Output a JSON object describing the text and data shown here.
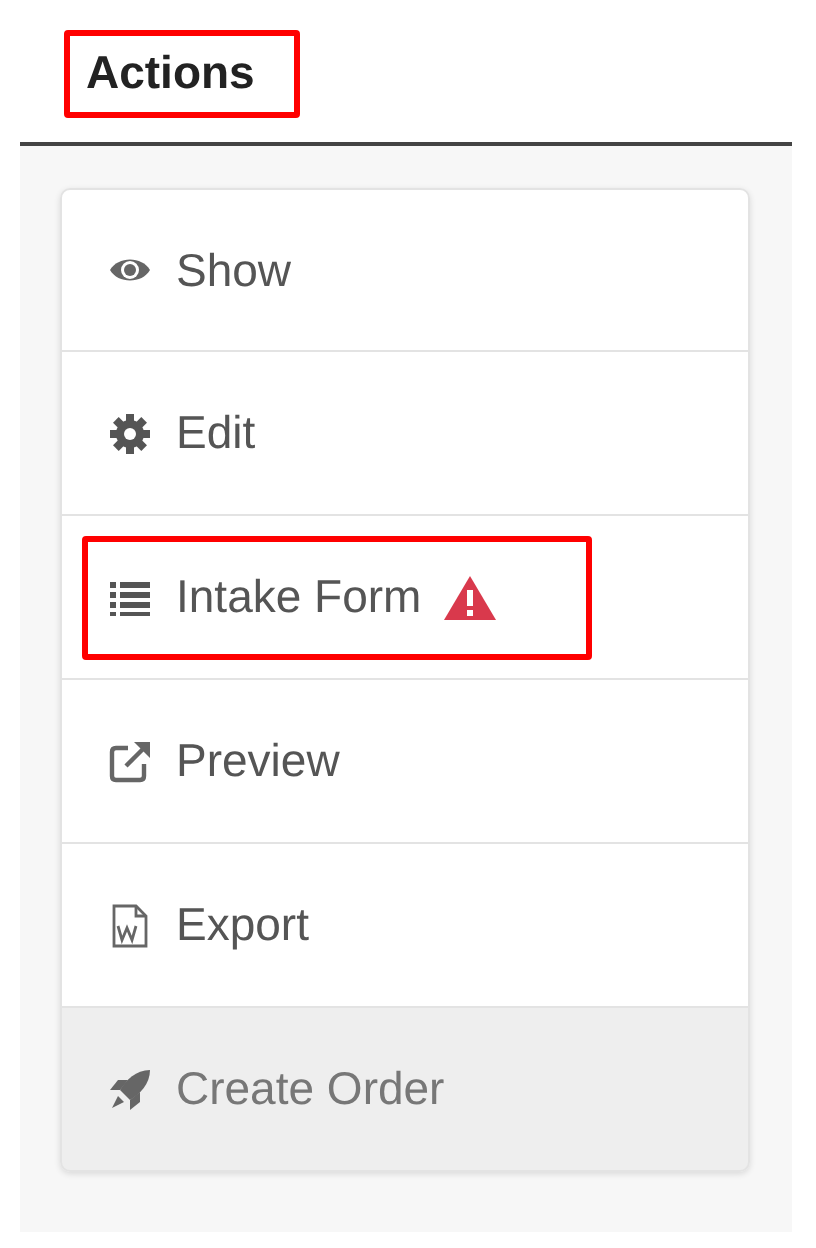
{
  "heading": {
    "text": "Actions",
    "highlighted": true
  },
  "actions": [
    {
      "label": "Show",
      "highlighted": false,
      "warning": false,
      "disabled": false
    },
    {
      "label": "Edit",
      "highlighted": false,
      "warning": false,
      "disabled": false
    },
    {
      "label": "Intake Form",
      "highlighted": true,
      "warning": true,
      "disabled": false
    },
    {
      "label": "Preview",
      "highlighted": false,
      "warning": false,
      "disabled": false
    },
    {
      "label": "Export",
      "highlighted": false,
      "warning": false,
      "disabled": false
    },
    {
      "label": "Create Order",
      "highlighted": false,
      "warning": false,
      "disabled": true
    }
  ]
}
